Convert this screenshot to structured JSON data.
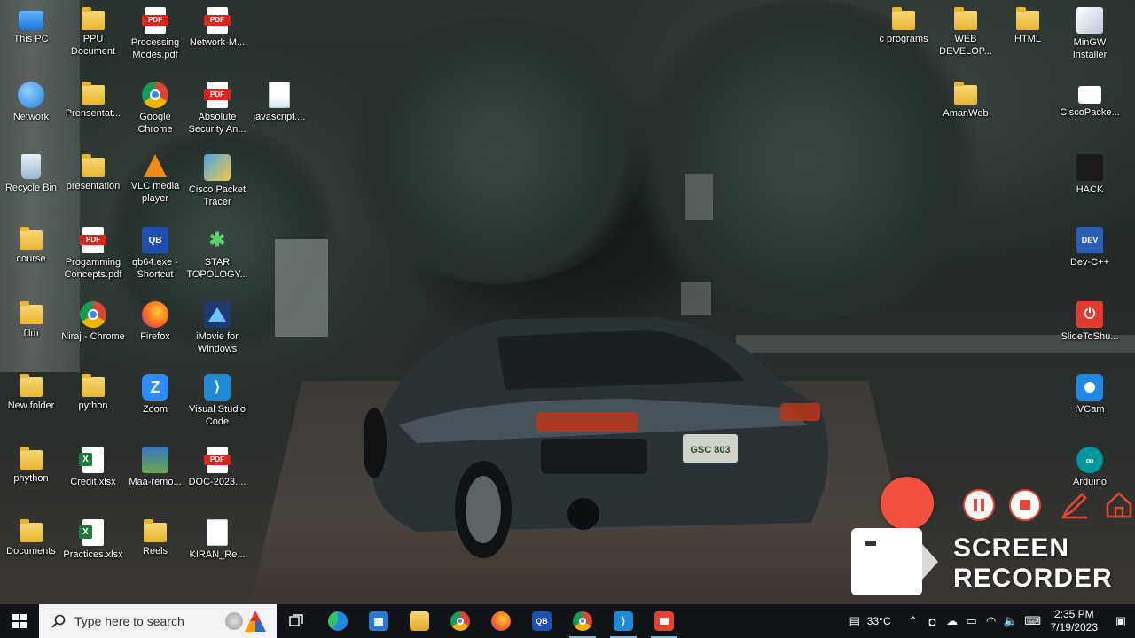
{
  "desktop": {
    "icons": [
      {
        "label": "This PC"
      },
      {
        "label": "PPU Document"
      },
      {
        "label": "Processing Modes.pdf"
      },
      {
        "label": "Network-M..."
      },
      {
        "label": "Network"
      },
      {
        "label": "Prensentat..."
      },
      {
        "label": "Google Chrome"
      },
      {
        "label": "Absolute Security An..."
      },
      {
        "label": "javascript...."
      },
      {
        "label": "Recycle Bin"
      },
      {
        "label": "presentation"
      },
      {
        "label": "VLC media player"
      },
      {
        "label": "Cisco Packet Tracer"
      },
      {
        "label": "course"
      },
      {
        "label": "Progamming Concepts.pdf"
      },
      {
        "label": "qb64.exe - Shortcut"
      },
      {
        "label": "STAR TOPOLOGY..."
      },
      {
        "label": "film"
      },
      {
        "label": "Niraj - Chrome"
      },
      {
        "label": "Firefox"
      },
      {
        "label": "iMovie for Windows"
      },
      {
        "label": "New folder"
      },
      {
        "label": "python"
      },
      {
        "label": "Zoom"
      },
      {
        "label": "Visual Studio Code"
      },
      {
        "label": "phython"
      },
      {
        "label": "Credit.xlsx"
      },
      {
        "label": "Maa-remo..."
      },
      {
        "label": "DOC-2023...."
      },
      {
        "label": "Documents"
      },
      {
        "label": "Practices.xlsx"
      },
      {
        "label": "Reels"
      },
      {
        "label": "KIRAN_Re..."
      },
      {
        "label": "c programs"
      },
      {
        "label": "WEB DEVELOP..."
      },
      {
        "label": "HTML"
      },
      {
        "label": "MinGW Installer"
      },
      {
        "label": "AmanWeb"
      },
      {
        "label": "CiscoPacke..."
      },
      {
        "label": "HACK"
      },
      {
        "label": "Dev-C++"
      },
      {
        "label": "SlideToShu..."
      },
      {
        "label": "iVCam"
      },
      {
        "label": "Arduino"
      }
    ]
  },
  "wallpaper": {
    "plate_text": "GSC 803"
  },
  "recorder": {
    "title_line1": "SCREEN",
    "title_line2": "RECORDER",
    "accent_color": "#f2513e"
  },
  "taskbar": {
    "search_placeholder": "Type here to search",
    "weather": "33°C",
    "time": "2:35 PM",
    "date": "7/19/2023"
  }
}
